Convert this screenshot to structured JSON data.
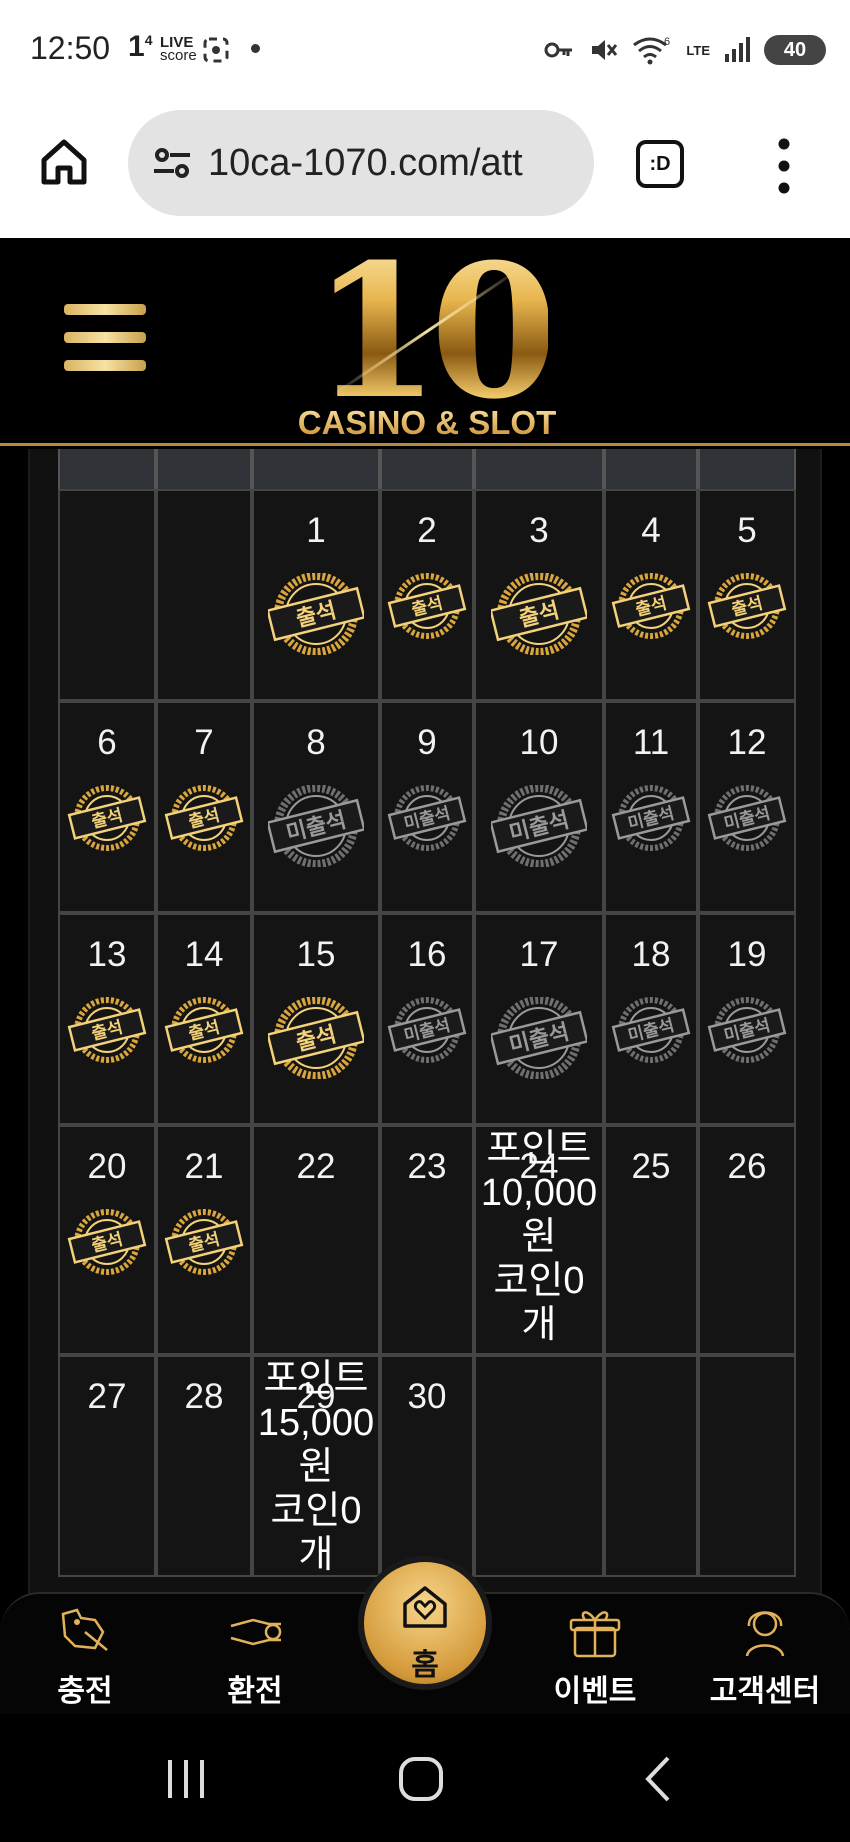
{
  "status_bar": {
    "time": "12:50",
    "notif_digit": "1",
    "notif_sup": "4",
    "live_top": "LIVE",
    "live_bottom": "score",
    "lte": "LTE",
    "wifi_badge": "6",
    "battery": "40"
  },
  "browser": {
    "url": "10ca-1070.com/att",
    "tab_label": ":D"
  },
  "site": {
    "logo_number": "10",
    "logo_sub": "CASINO & SLOT"
  },
  "calendar": {
    "stamp_attended": "출석",
    "stamp_absent": "미출석",
    "rows": [
      [
        {
          "day": "",
          "stamp": ""
        },
        {
          "day": "",
          "stamp": ""
        },
        {
          "day": "1",
          "stamp": "attended",
          "big": true
        },
        {
          "day": "2",
          "stamp": "attended"
        },
        {
          "day": "3",
          "stamp": "attended",
          "big": true
        },
        {
          "day": "4",
          "stamp": "attended"
        },
        {
          "day": "5",
          "stamp": "attended"
        }
      ],
      [
        {
          "day": "6",
          "stamp": "attended"
        },
        {
          "day": "7",
          "stamp": "attended"
        },
        {
          "day": "8",
          "stamp": "absent",
          "big": true
        },
        {
          "day": "9",
          "stamp": "absent"
        },
        {
          "day": "10",
          "stamp": "absent",
          "big": true
        },
        {
          "day": "11",
          "stamp": "absent"
        },
        {
          "day": "12",
          "stamp": "absent"
        }
      ],
      [
        {
          "day": "13",
          "stamp": "attended"
        },
        {
          "day": "14",
          "stamp": "attended"
        },
        {
          "day": "15",
          "stamp": "attended",
          "big": true
        },
        {
          "day": "16",
          "stamp": "absent"
        },
        {
          "day": "17",
          "stamp": "absent",
          "big": true
        },
        {
          "day": "18",
          "stamp": "absent"
        },
        {
          "day": "19",
          "stamp": "absent"
        }
      ],
      [
        {
          "day": "20",
          "stamp": "attended"
        },
        {
          "day": "21",
          "stamp": "attended"
        },
        {
          "day": "22",
          "stamp": ""
        },
        {
          "day": "23",
          "stamp": ""
        },
        {
          "day": "24",
          "stamp": "",
          "prize": [
            "포인트",
            "10,000",
            "원",
            "코인0",
            "개"
          ]
        },
        {
          "day": "25",
          "stamp": ""
        },
        {
          "day": "26",
          "stamp": ""
        }
      ],
      [
        {
          "day": "27",
          "stamp": ""
        },
        {
          "day": "28",
          "stamp": ""
        },
        {
          "day": "29",
          "stamp": "",
          "prize": [
            "포인트",
            "15,000",
            "원",
            "코인0",
            "개"
          ]
        },
        {
          "day": "30",
          "stamp": ""
        },
        {
          "day": "",
          "stamp": ""
        },
        {
          "day": "",
          "stamp": ""
        },
        {
          "day": "",
          "stamp": ""
        }
      ]
    ]
  },
  "bottom_nav": {
    "items": [
      {
        "label": "충전",
        "icon": "charge-icon"
      },
      {
        "label": "환전",
        "icon": "exchange-icon"
      },
      {
        "label": "홈",
        "icon": "home-heart-icon"
      },
      {
        "label": "이벤트",
        "icon": "gift-icon"
      },
      {
        "label": "고객센터",
        "icon": "support-icon"
      }
    ]
  },
  "colors": {
    "gold": "#d4a23f",
    "gold_light": "#f3d58a",
    "absent_gray": "#7a7a7a",
    "cell_bg": "#141414",
    "grid_line": "#454545"
  }
}
